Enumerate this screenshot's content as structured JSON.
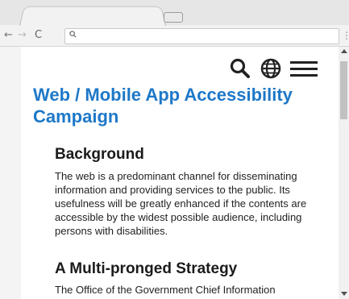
{
  "browser": {
    "back_icon": "back-arrow-icon",
    "forward_icon": "forward-arrow-icon",
    "reload_icon": "reload-icon",
    "search_icon": "magnifier-icon",
    "menu_icon": "more-vertical-icon"
  },
  "header": {
    "icons": [
      "search-icon",
      "globe-icon",
      "hamburger-menu-icon"
    ]
  },
  "page": {
    "title": "Web / Mobile App Accessibility Campaign",
    "sections": [
      {
        "heading": "Background",
        "body": "The web is a predominant channel for disseminating information and providing services to the public. Its usefulness will be greatly enhanced if the contents are accessible by the widest possible audience, including persons with disabilities."
      },
      {
        "heading": "A Multi-pronged Strategy",
        "body": "The Office of the Government Chief Information"
      }
    ]
  },
  "colors": {
    "title": "#1e78c8",
    "text": "#222222"
  }
}
